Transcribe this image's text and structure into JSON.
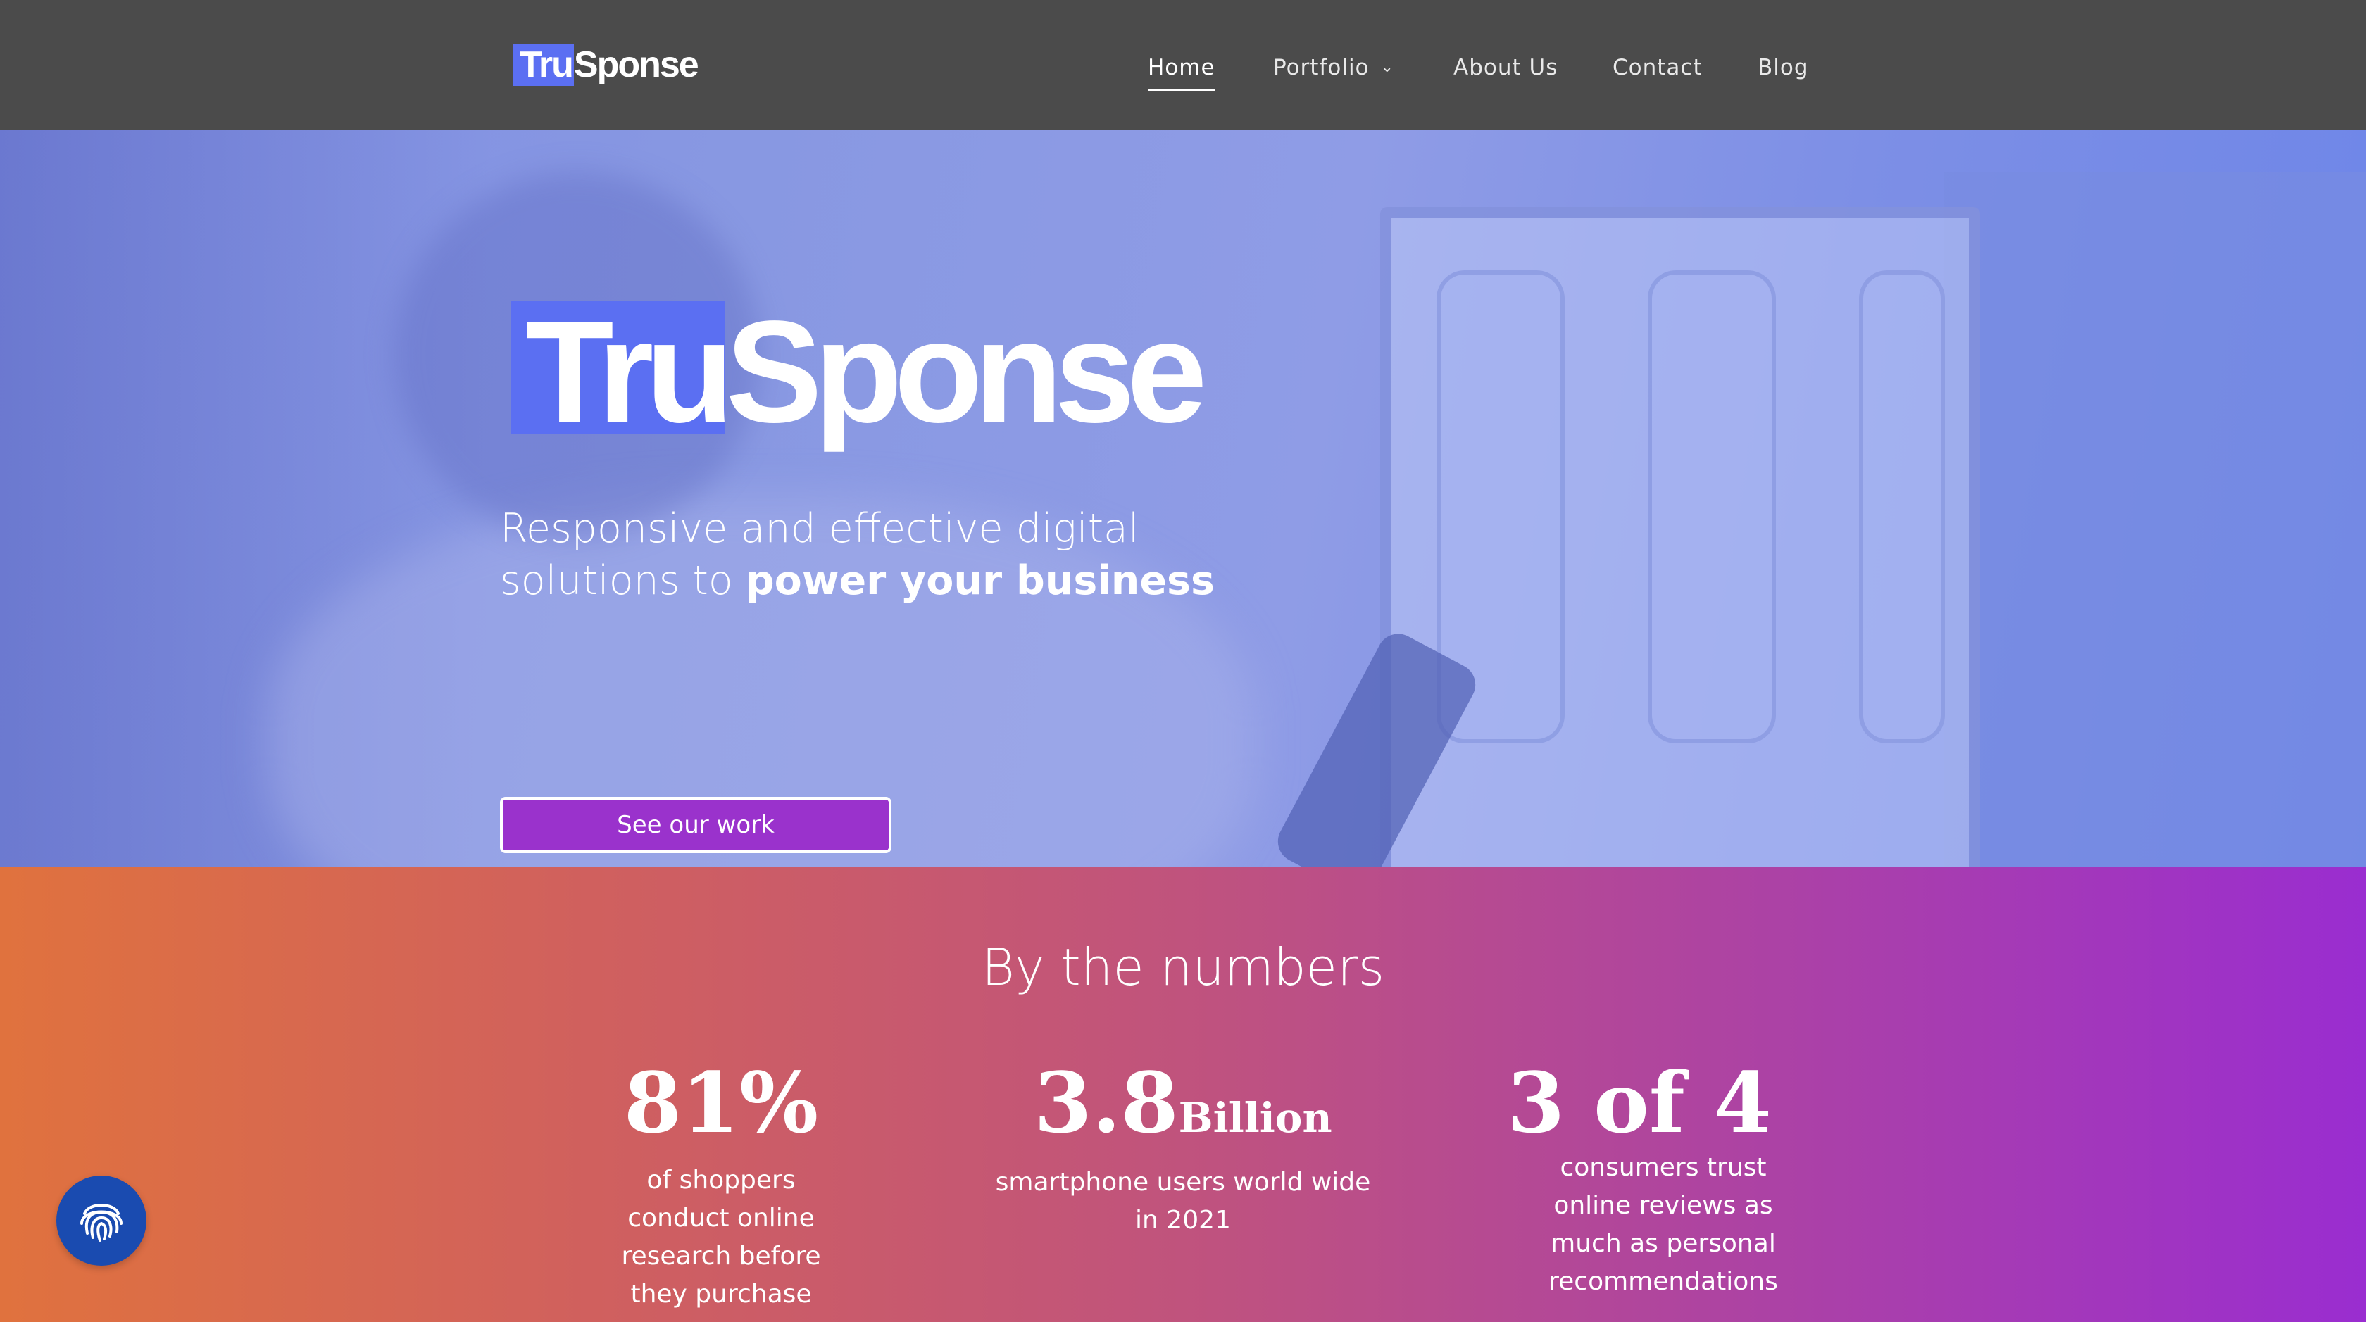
{
  "nav": {
    "logo": {
      "part1": "Tru",
      "part2": "Sponse"
    },
    "links": [
      {
        "label": "Home",
        "active": true
      },
      {
        "label": "Portfolio",
        "has_dropdown": true
      },
      {
        "label": "About Us"
      },
      {
        "label": "Contact"
      },
      {
        "label": "Blog"
      }
    ]
  },
  "hero": {
    "logo": {
      "part1": "Tru",
      "part2": "Sponse"
    },
    "tagline_line1": "Responsive and effective digital",
    "tagline_line2_prefix": "solutions to ",
    "tagline_line2_bold": "power your business",
    "cta_label": "See our work"
  },
  "numbers": {
    "title": "By the numbers",
    "stats": [
      {
        "value": "81%",
        "suffix": "",
        "desc": "of shoppers conduct online research before they purchase"
      },
      {
        "value": "3.8",
        "suffix": "Billion",
        "desc": "smartphone users world wide in 2021"
      },
      {
        "value": "3 of 4",
        "suffix": "",
        "desc": "consumers trust online reviews as much as personal recommendations"
      }
    ]
  },
  "fab": {
    "icon": "fingerprint-icon"
  },
  "colors": {
    "nav_bg": "#4b4b4b",
    "logo_highlight": "#5b6ff2",
    "cta_bg": "#9a32cc",
    "gradient_start": "#e0723e",
    "gradient_end": "#9a2dd0",
    "fab_bg": "#1a4bb0"
  }
}
